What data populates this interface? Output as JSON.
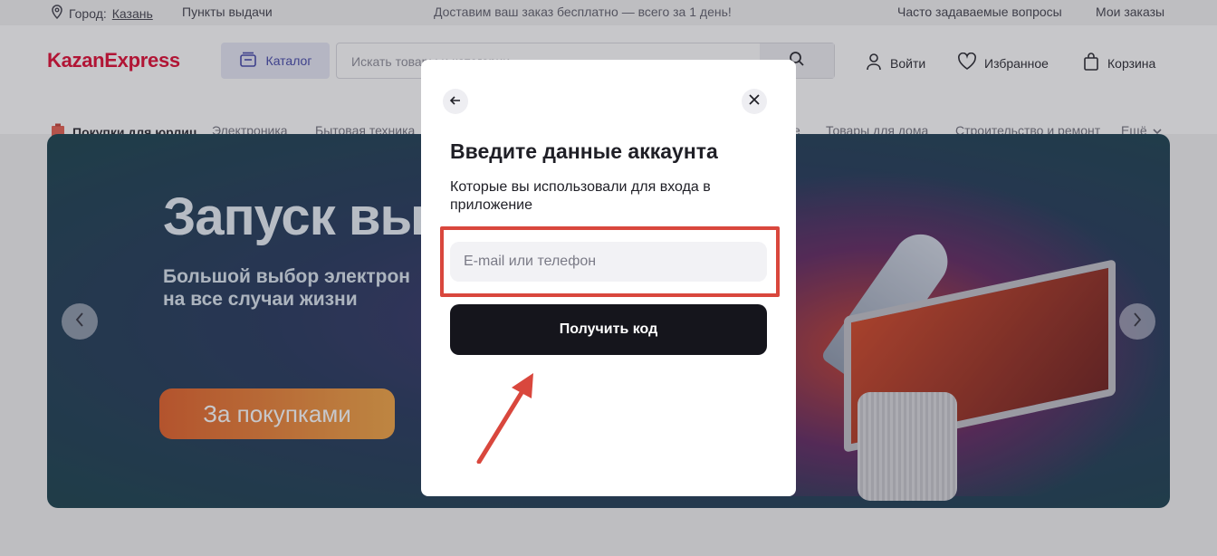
{
  "topbar": {
    "city_prefix": "Город:",
    "city": "Казань",
    "pickup_points": "Пункты выдачи",
    "promo": "Доставим ваш заказ бесплатно — всего за 1 день!",
    "faq": "Часто задаваемые вопросы",
    "my_orders": "Мои заказы"
  },
  "header": {
    "logo": "KazanExpress",
    "catalog": "Каталог",
    "search_placeholder": "Искать товары и категории",
    "login": "Войти",
    "favorites": "Избранное",
    "cart": "Корзина"
  },
  "nav": {
    "b2b": "Покупки для юрлиц",
    "items": [
      "Электроника",
      "Бытовая техника",
      "е",
      "Товары для дома",
      "Строительство и ремонт"
    ],
    "more": "Ещё"
  },
  "banner": {
    "title": "Запуск вы",
    "subtitle": "Большой выбор электрон на все случаи жизни",
    "cta": "За покупками"
  },
  "modal": {
    "title": "Введите данные аккаунта",
    "subtitle": "Которые вы использовали для входа в приложение",
    "input_placeholder": "E-mail или телефон",
    "input_value": "",
    "submit": "Получить код"
  },
  "colors": {
    "brand": "#e0002a",
    "highlight": "#d9473d",
    "button": "#15151c"
  },
  "icons": [
    "location-icon",
    "catalog-icon",
    "search-icon",
    "user-icon",
    "heart-icon",
    "bag-icon",
    "chevron-down-icon",
    "arrow-left-icon",
    "close-icon",
    "chevron-left-icon",
    "chevron-right-icon"
  ]
}
